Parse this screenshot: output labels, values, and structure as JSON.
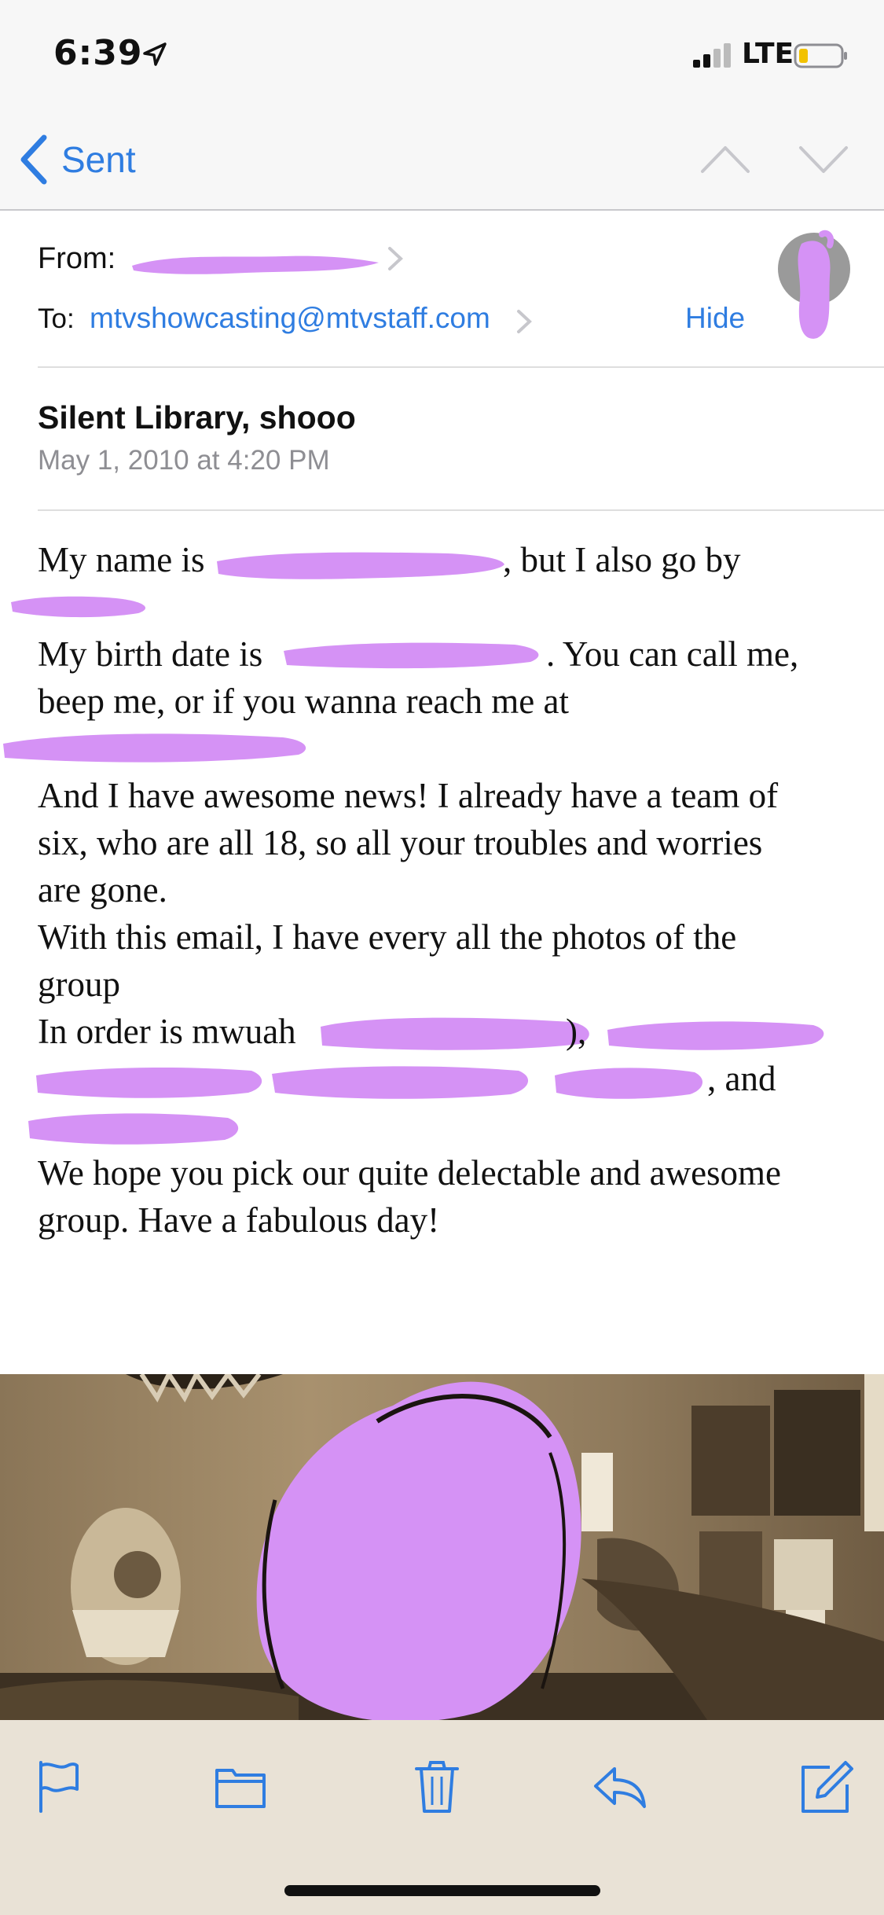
{
  "status_bar": {
    "time": "6:39",
    "network": "LTE"
  },
  "nav": {
    "back_label": "Sent"
  },
  "header": {
    "from_label": "From:",
    "to_label": "To:",
    "to_address": "mtvshowcasting@mtvstaff.com",
    "hide_label": "Hide",
    "subject": "Silent Library, shooo",
    "date": "May 1, 2010 at 4:20 PM"
  },
  "body": {
    "line1_a": "My name is",
    "line1_b": ", but I also go by",
    "line2_a": "My birth date is",
    "line2_b": ". You can call me,",
    "line3": "beep me, or if you wanna reach me at",
    "line4": "And I have awesome news! I already have a team of",
    "line5": "six, who are all 18, so all your troubles and worries",
    "line6": "are gone.",
    "line7": "With this email, I have every all the photos of the",
    "line8": "group",
    "line9_a": "In order is mwuah",
    "line9_b": "),",
    "line10_b": ", and",
    "line11": "We hope you pick our quite delectable and awesome",
    "line12": "group. Have a fabulous day!"
  },
  "toolbar": {
    "items": [
      "flag-icon",
      "folder-icon",
      "trash-icon",
      "reply-icon",
      "compose-icon"
    ]
  },
  "colors": {
    "accent": "#2f7de1",
    "redaction": "#d592f5",
    "photo_tone": "#9a8463"
  }
}
